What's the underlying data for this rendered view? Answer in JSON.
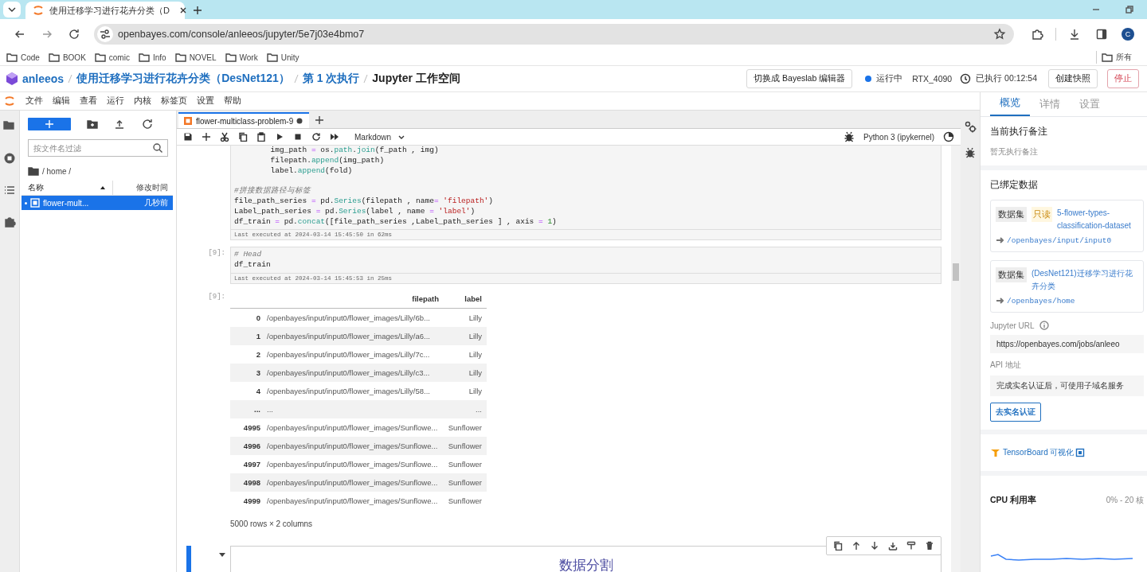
{
  "browser": {
    "tab": {
      "title": "使用迁移学习进行花卉分类（D"
    },
    "address": "openbayes.com/console/anleeos/jupyter/5e7j03e4bmo7",
    "avatar": "C",
    "bookmarks": [
      "Code",
      "BOOK",
      "comic",
      "Info",
      "NOVEL",
      "Work",
      "Unity"
    ],
    "bookmarks_more": "所有"
  },
  "header": {
    "breadcrumb": [
      {
        "text": "anleeos",
        "kind": "link"
      },
      {
        "text": "使用迁移学习进行花卉分类（DesNet121）",
        "kind": "link"
      },
      {
        "text": "第 1 次执行",
        "kind": "link"
      },
      {
        "text": "Jupyter 工作空间",
        "kind": "current"
      }
    ],
    "switch_button": "切换成 Bayeslab 编辑器",
    "status": "运行中",
    "gpu": "RTX_4090",
    "elapsed": "已执行 00:12:54",
    "snapshot_button": "创建快照",
    "stop_button": "停止"
  },
  "jupyter": {
    "menu": [
      "文件",
      "编辑",
      "查看",
      "运行",
      "内核",
      "标签页",
      "设置",
      "帮助"
    ],
    "file_browser": {
      "filter_placeholder": "按文件名过滤",
      "path": "/ home /",
      "columns": [
        "名称",
        "修改时间"
      ],
      "files": [
        {
          "name": "flower-mult...",
          "modified": "几秒前",
          "selected": true,
          "running": true
        }
      ]
    },
    "notebook": {
      "tab": {
        "title": "flower-multiclass-problem-9",
        "modified": true
      },
      "cell_type": "Markdown",
      "kernel": "Python 3 (ipykernel)",
      "cells": [
        {
          "kind": "code",
          "lines": [
            {
              "kind": "code",
              "tokens": [
                {
                  "kind": "plain",
                  "text": "        img_path "
                },
                {
                  "kind": "op",
                  "text": "="
                },
                {
                  "kind": "plain",
                  "text": " os."
                },
                {
                  "kind": "func",
                  "text": "path"
                },
                {
                  "kind": "plain",
                  "text": "."
                },
                {
                  "kind": "func",
                  "text": "join"
                },
                {
                  "kind": "plain",
                  "text": "(f_path , img)"
                }
              ]
            },
            {
              "kind": "code",
              "tokens": [
                {
                  "kind": "plain",
                  "text": "        filepath."
                },
                {
                  "kind": "func",
                  "text": "append"
                },
                {
                  "kind": "plain",
                  "text": "(img_path)"
                }
              ]
            },
            {
              "kind": "code",
              "tokens": [
                {
                  "kind": "plain",
                  "text": "        label."
                },
                {
                  "kind": "func",
                  "text": "append"
                },
                {
                  "kind": "plain",
                  "text": "(fold)"
                }
              ]
            },
            {
              "kind": "blank"
            },
            {
              "kind": "code",
              "tokens": [
                {
                  "kind": "comment",
                  "text": "#拼接数据路径与标签"
                }
              ]
            },
            {
              "kind": "code",
              "tokens": [
                {
                  "kind": "plain",
                  "text": "file_path_series "
                },
                {
                  "kind": "op",
                  "text": "="
                },
                {
                  "kind": "plain",
                  "text": " pd."
                },
                {
                  "kind": "func",
                  "text": "Series"
                },
                {
                  "kind": "plain",
                  "text": "(filepath , name"
                },
                {
                  "kind": "op",
                  "text": "="
                },
                {
                  "kind": "str",
                  "text": " 'filepath'"
                },
                {
                  "kind": "plain",
                  "text": ")"
                }
              ]
            },
            {
              "kind": "code",
              "tokens": [
                {
                  "kind": "plain",
                  "text": "Label_path_series "
                },
                {
                  "kind": "op",
                  "text": "="
                },
                {
                  "kind": "plain",
                  "text": " pd."
                },
                {
                  "kind": "func",
                  "text": "Series"
                },
                {
                  "kind": "plain",
                  "text": "(label , name "
                },
                {
                  "kind": "op",
                  "text": "="
                },
                {
                  "kind": "str",
                  "text": " 'label'"
                },
                {
                  "kind": "plain",
                  "text": ")"
                }
              ]
            },
            {
              "kind": "code",
              "tokens": [
                {
                  "kind": "plain",
                  "text": "df_train "
                },
                {
                  "kind": "op",
                  "text": "="
                },
                {
                  "kind": "plain",
                  "text": " pd."
                },
                {
                  "kind": "func",
                  "text": "concat"
                },
                {
                  "kind": "plain",
                  "text": "([file_path_series ,Label_path_series ] , axis "
                },
                {
                  "kind": "op",
                  "text": "="
                },
                {
                  "kind": "num",
                  "text": " 1"
                },
                {
                  "kind": "plain",
                  "text": ")"
                }
              ]
            }
          ],
          "executed": "Last executed at 2024-03-14 15:45:50 in 62ms"
        },
        {
          "kind": "code",
          "prompt": "[9]:",
          "lines": [
            {
              "kind": "code",
              "tokens": [
                {
                  "kind": "comment",
                  "text": "# Head"
                }
              ]
            },
            {
              "kind": "code",
              "tokens": [
                {
                  "kind": "plain",
                  "text": "df_train"
                }
              ]
            }
          ],
          "executed": "Last executed at 2024-03-14 15:45:53 in 25ms"
        },
        {
          "kind": "output",
          "prompt": "[9]:",
          "table": {
            "columns": [
              "filepath",
              "label"
            ],
            "rows": [
              {
                "index": "0",
                "filepath": "/openbayes/input/input0/flower_images/Lilly/6b...",
                "label": "Lilly"
              },
              {
                "index": "1",
                "filepath": "/openbayes/input/input0/flower_images/Lilly/a6...",
                "label": "Lilly"
              },
              {
                "index": "2",
                "filepath": "/openbayes/input/input0/flower_images/Lilly/7c...",
                "label": "Lilly"
              },
              {
                "index": "3",
                "filepath": "/openbayes/input/input0/flower_images/Lilly/c3...",
                "label": "Lilly"
              },
              {
                "index": "4",
                "filepath": "/openbayes/input/input0/flower_images/Lilly/58...",
                "label": "Lilly"
              },
              {
                "index": "...",
                "filepath": "...",
                "label": "..."
              },
              {
                "index": "4995",
                "filepath": "/openbayes/input/input0/flower_images/Sunflowe...",
                "label": "Sunflower"
              },
              {
                "index": "4996",
                "filepath": "/openbayes/input/input0/flower_images/Sunflowe...",
                "label": "Sunflower"
              },
              {
                "index": "4997",
                "filepath": "/openbayes/input/input0/flower_images/Sunflowe...",
                "label": "Sunflower"
              },
              {
                "index": "4998",
                "filepath": "/openbayes/input/input0/flower_images/Sunflowe...",
                "label": "Sunflower"
              },
              {
                "index": "4999",
                "filepath": "/openbayes/input/input0/flower_images/Sunflowe...",
                "label": "Sunflower"
              }
            ]
          },
          "summary": "5000 rows × 2 columns"
        },
        {
          "kind": "markdown",
          "heading": "数据分割",
          "active": true
        }
      ]
    }
  },
  "panel": {
    "tabs": [
      {
        "label": "概览",
        "selected": true
      },
      {
        "label": "详情",
        "selected": false
      },
      {
        "label": "设置",
        "selected": false
      }
    ],
    "note": {
      "title": "当前执行备注",
      "text": "暂无执行备注"
    },
    "bound": {
      "title": "已绑定数据",
      "items": [
        {
          "type": "数据集",
          "tag": "只读",
          "name": "5-flower-types-classification-dataset",
          "path": "/openbayes/input/input0"
        },
        {
          "type": "数据集",
          "name": "(DesNet121)迁移学习进行花卉分类",
          "path": "/openbayes/home"
        }
      ]
    },
    "jupyter_url": {
      "label": "Jupyter URL",
      "value": "https://openbayes.com/jobs/anleeo"
    },
    "api": {
      "label": "API 地址",
      "value": "完成实名认证后，可使用子域名服务",
      "button": "去实名认证"
    },
    "tensorboard": "TensorBoard 可视化",
    "cpu": {
      "title": "CPU 利用率",
      "range": "0% - 20 核"
    }
  }
}
